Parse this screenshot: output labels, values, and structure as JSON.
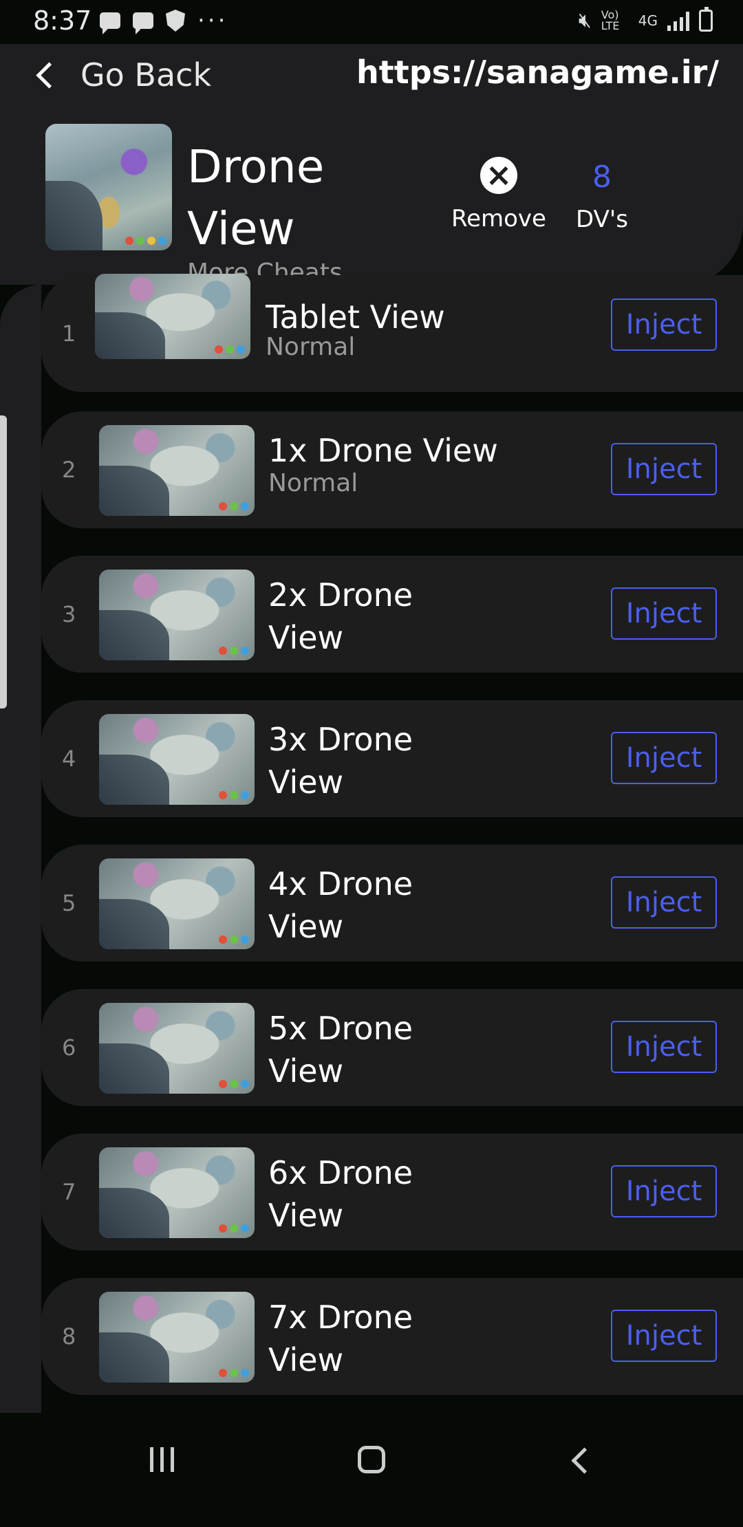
{
  "status_bar": {
    "time": "8:37",
    "icons_left": [
      "message-icon",
      "message-icon",
      "shield-icon",
      "more-dots-icon"
    ],
    "icons_right": [
      "mute-icon",
      "volte-icon",
      "4g-icon",
      "signal-icon",
      "battery-icon"
    ],
    "volte_label": "Vo) LTE",
    "network_label": "4G"
  },
  "header": {
    "back_label": "Go Back",
    "url": "https://sanagame.ir/",
    "title": "Drone View",
    "subtitle": "More Cheats",
    "remove_label": "Remove",
    "remove_icon": "close-circle-icon",
    "count_value": "8",
    "count_label": "DV's",
    "accent_color": "#4a5ff0"
  },
  "items": [
    {
      "num": "1",
      "title": "Tablet View",
      "subtitle": "Normal",
      "button": "Inject"
    },
    {
      "num": "2",
      "title": "1x Drone View",
      "subtitle": "Normal",
      "button": "Inject"
    },
    {
      "num": "3",
      "title": "2x Drone View",
      "subtitle": "",
      "button": "Inject"
    },
    {
      "num": "4",
      "title": "3x Drone View",
      "subtitle": "",
      "button": "Inject"
    },
    {
      "num": "5",
      "title": "4x Drone View",
      "subtitle": "",
      "button": "Inject"
    },
    {
      "num": "6",
      "title": "5x Drone View",
      "subtitle": "",
      "button": "Inject"
    },
    {
      "num": "7",
      "title": "6x Drone View",
      "subtitle": "",
      "button": "Inject"
    },
    {
      "num": "8",
      "title": "7x Drone View",
      "subtitle": "",
      "button": "Inject"
    }
  ],
  "nav_bar": {
    "icons": [
      "recents-icon",
      "home-icon",
      "back-icon"
    ]
  }
}
